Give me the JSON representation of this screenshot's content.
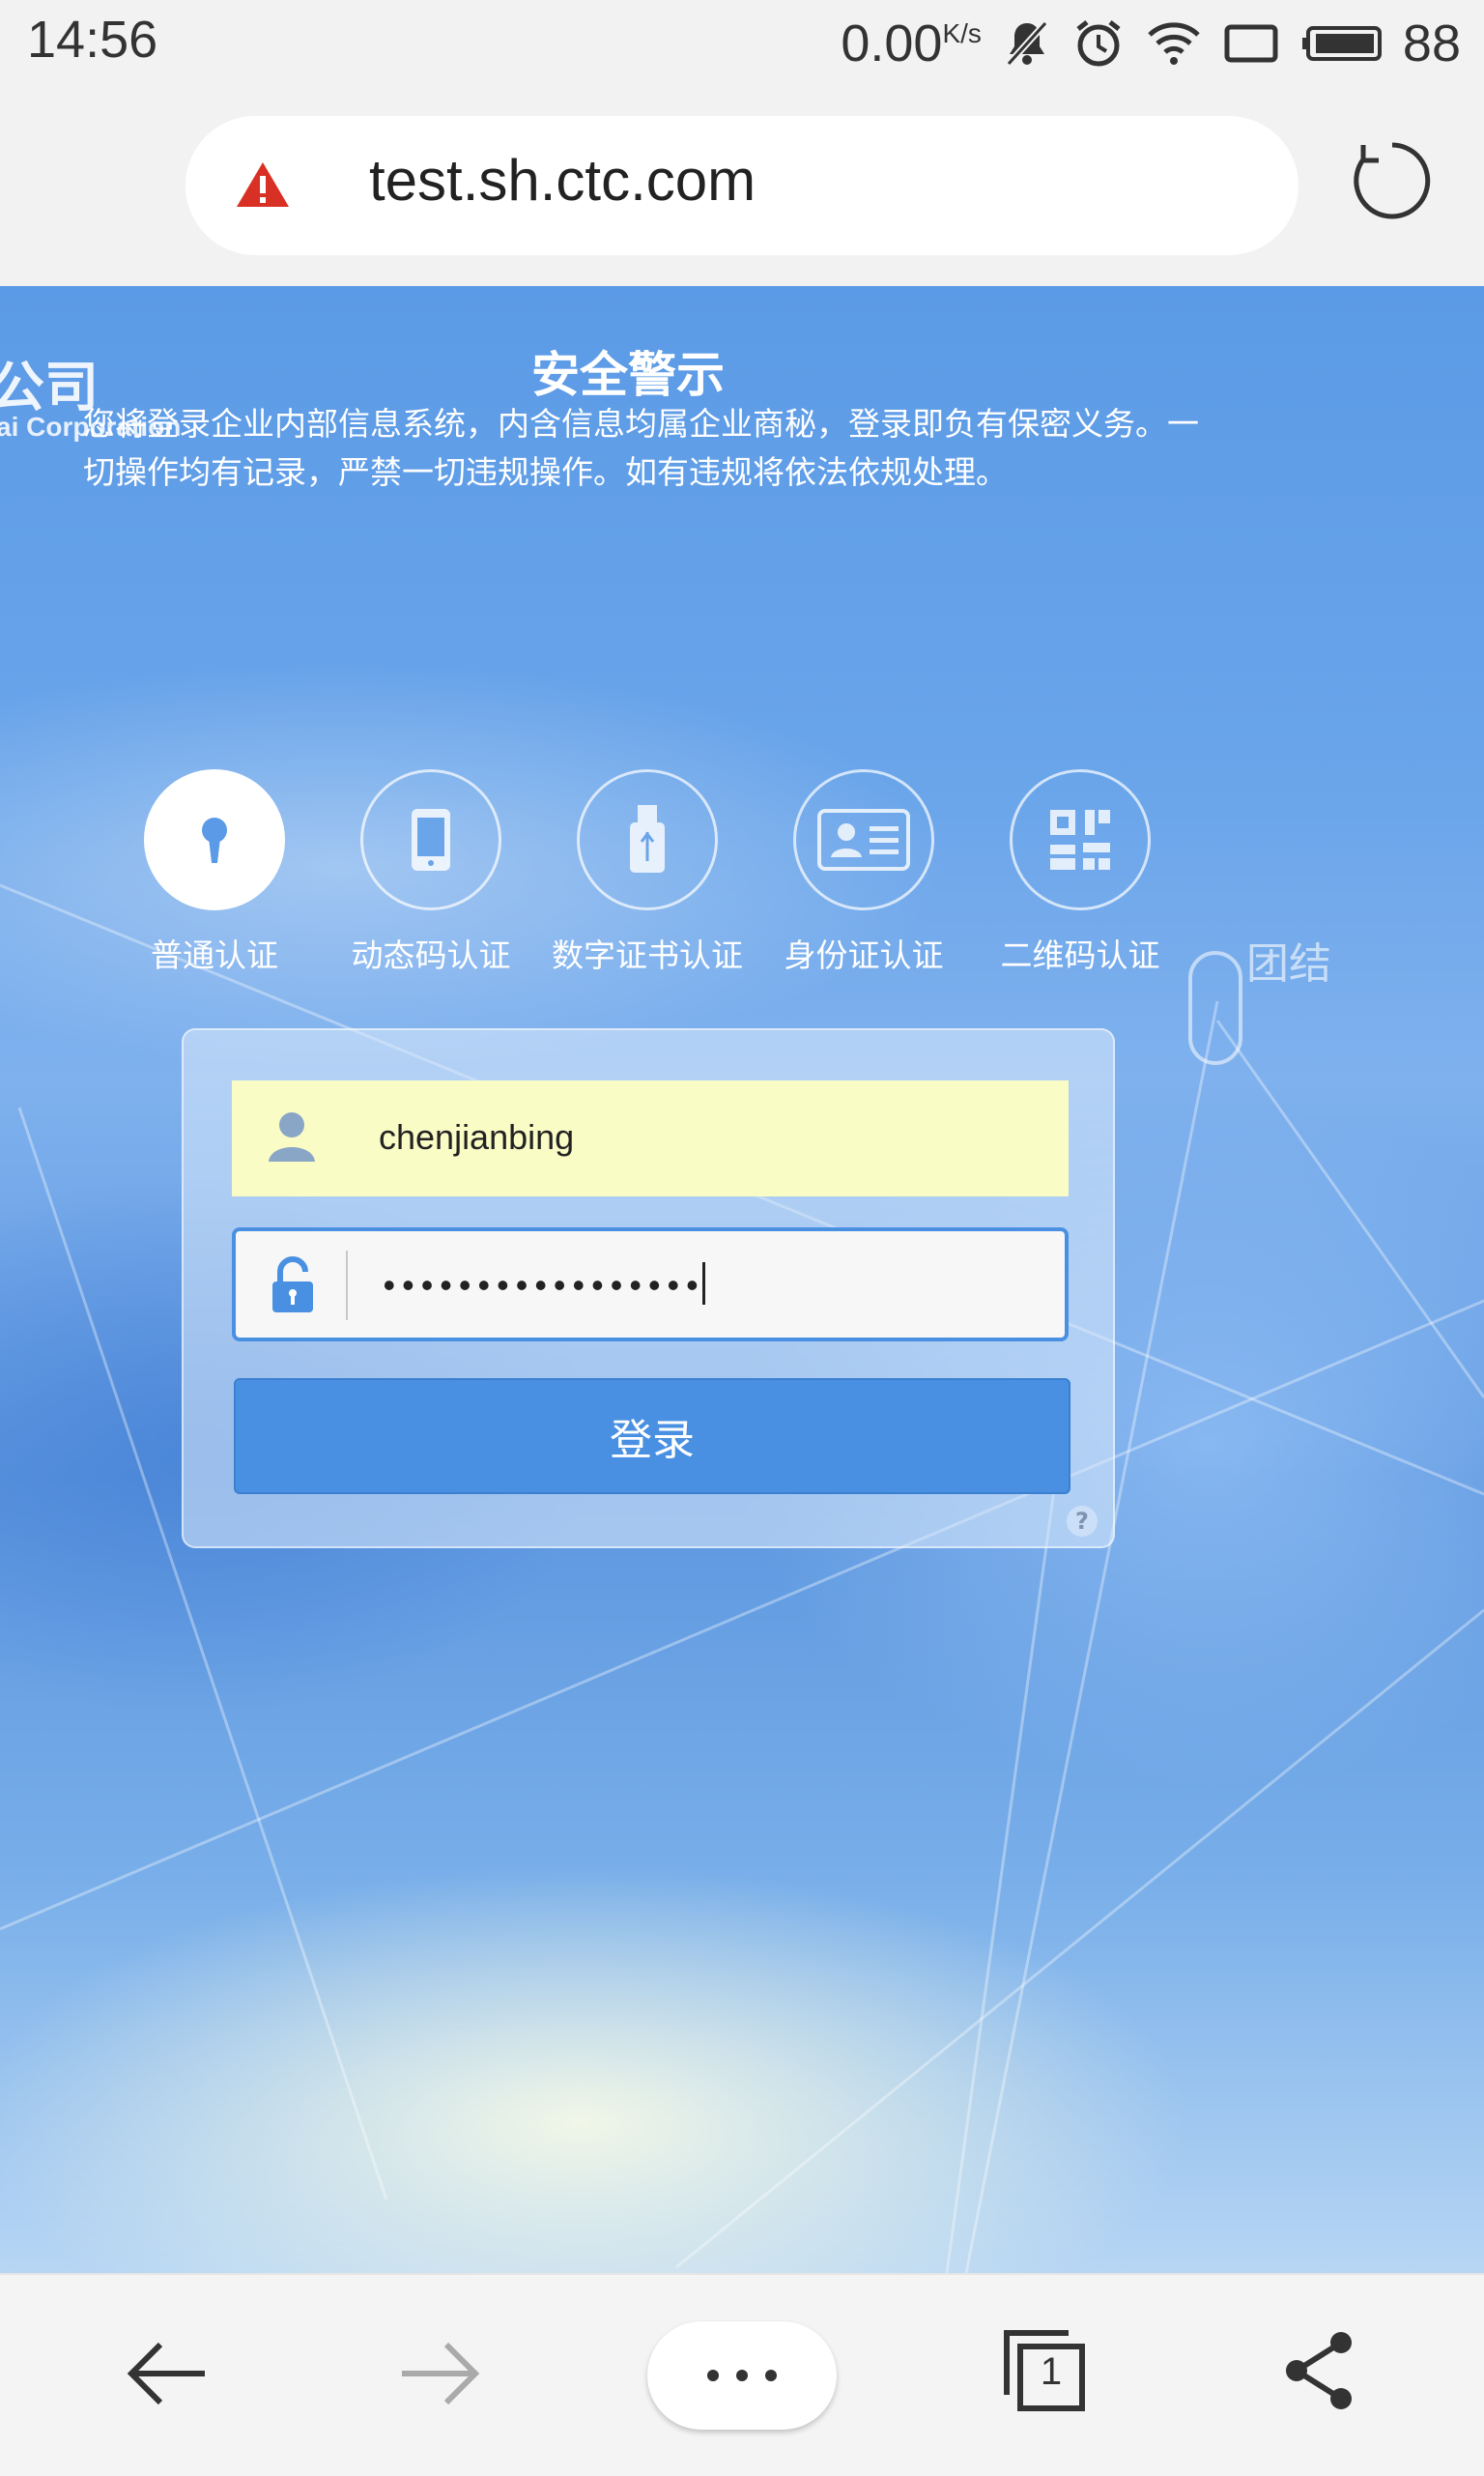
{
  "status_bar": {
    "time": "14:56",
    "net_speed": "0.00",
    "net_unit": "K/s",
    "battery": "88",
    "icons": [
      "mute-icon",
      "alarm-icon",
      "wifi-icon",
      "screen-icon",
      "battery-icon"
    ]
  },
  "browser": {
    "url": "test.sh.ctc.com",
    "security": "warning-icon"
  },
  "page": {
    "corp_cn": "公司",
    "corp_en": "ai Corporation",
    "warning_title": "安全警示",
    "warning_body": "您将登录企业内部信息系统，内含信息均属企业商秘，登录即负有保密义务。一切操作均有记录，严禁一切违规操作。如有违规将依法依规处理。",
    "side_label": "团结",
    "auth_methods": [
      {
        "label": "普通认证",
        "icon": "keyhole-icon",
        "active": true
      },
      {
        "label": "动态码认证",
        "icon": "phone-icon",
        "active": false
      },
      {
        "label": "数字证书认证",
        "icon": "usb-key-icon",
        "active": false
      },
      {
        "label": "身份证认证",
        "icon": "id-card-icon",
        "active": false
      },
      {
        "label": "二维码认证",
        "icon": "qr-code-icon",
        "active": false
      }
    ],
    "login": {
      "username": "chenjianbing",
      "password_mask": "•••••••••••••••••",
      "submit_label": "登录",
      "help": "?"
    }
  },
  "bottom_nav": {
    "tab_count": "1"
  },
  "colors": {
    "accent": "#4a90e2",
    "autofill": "#fafcc6",
    "warning": "#d93025"
  }
}
